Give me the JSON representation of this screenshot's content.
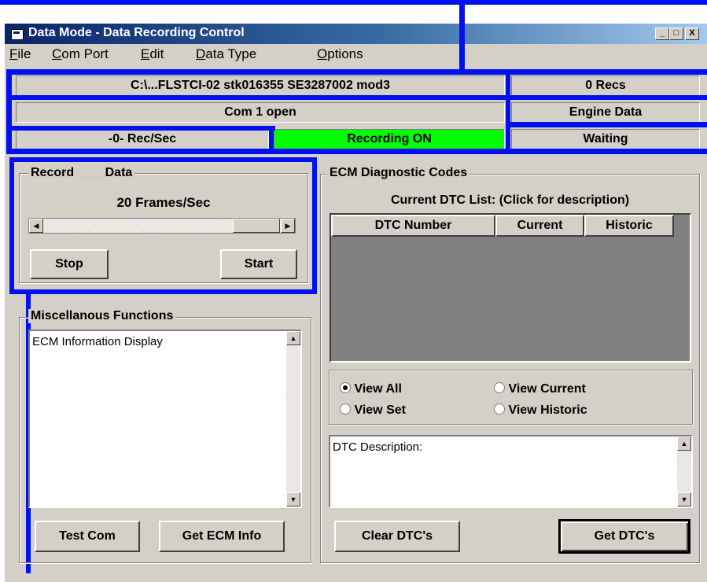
{
  "window": {
    "title": "Data Mode - Data Recording Control",
    "controls": [
      "_",
      "□",
      "X"
    ]
  },
  "menu": [
    "File",
    "Com Port",
    "Edit",
    "Data Type",
    "Options"
  ],
  "status": {
    "file": "C:\\...FLSTCI-02 stk016355 SE3287002 mod3",
    "recs": "0 Recs",
    "port": "Com 1 open",
    "data_type": "Engine Data",
    "rate": "-0- Rec/Sec",
    "recording": "Recording ON",
    "state": "Waiting",
    "recording_color": "#00ff00"
  },
  "record": {
    "title_left": "Record",
    "title_right": "Data",
    "frames": "20 Frames/Sec",
    "slider_level": 1.0,
    "stop": "Stop",
    "start": "Start"
  },
  "misc": {
    "title": "Miscellanous Functions",
    "items": [
      "ECM Information Display"
    ],
    "test_com": "Test Com",
    "get_ecm": "Get ECM Info"
  },
  "ecm": {
    "title": "ECM Diagnostic Codes",
    "subtitle": "Current DTC List: (Click for description)",
    "columns": [
      "DTC Number",
      "Current",
      "Historic"
    ],
    "radios": [
      {
        "label": "View All",
        "checked": true
      },
      {
        "label": "View Current",
        "checked": false
      },
      {
        "label": "View Set",
        "checked": false
      },
      {
        "label": "View Historic",
        "checked": false
      }
    ],
    "desc_label": "DTC Description:",
    "clear": "Clear DTC's",
    "get": "Get DTC's"
  },
  "colors": {
    "annotation": "#0010ee",
    "window": "#d4d0c8",
    "title_start": "#0a246a"
  }
}
